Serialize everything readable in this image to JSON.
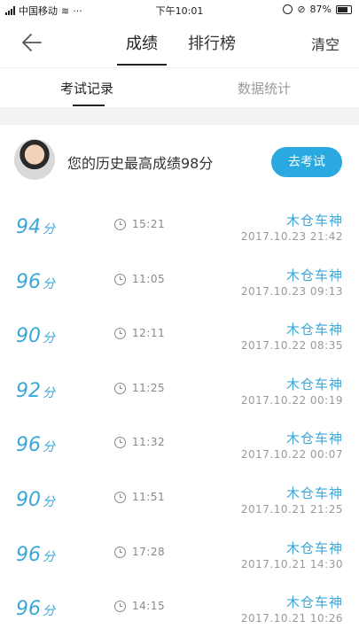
{
  "status_bar": {
    "carrier": "中国移动",
    "dots": "···",
    "time": "下午10:01",
    "battery": "87%"
  },
  "nav": {
    "tab_score": "成绩",
    "tab_rank": "排行榜",
    "clear": "清空"
  },
  "subtabs": {
    "records": "考试记录",
    "stats": "数据统计"
  },
  "summary": {
    "best_text": "您的历史最高成绩98分",
    "exam_button": "去考试"
  },
  "score_unit": "分",
  "records": [
    {
      "score": "94",
      "duration": "15:21",
      "name": "木仓车神",
      "date": "2017.10.23  21:42"
    },
    {
      "score": "96",
      "duration": "11:05",
      "name": "木仓车神",
      "date": "2017.10.23  09:13"
    },
    {
      "score": "90",
      "duration": "12:11",
      "name": "木仓车神",
      "date": "2017.10.22  08:35"
    },
    {
      "score": "92",
      "duration": "11:25",
      "name": "木仓车神",
      "date": "2017.10.22  00:19"
    },
    {
      "score": "96",
      "duration": "11:32",
      "name": "木仓车神",
      "date": "2017.10.22  00:07"
    },
    {
      "score": "90",
      "duration": "11:51",
      "name": "木仓车神",
      "date": "2017.10.21  21:25"
    },
    {
      "score": "96",
      "duration": "17:28",
      "name": "木仓车神",
      "date": "2017.10.21  14:30"
    },
    {
      "score": "96",
      "duration": "14:15",
      "name": "木仓车神",
      "date": "2017.10.21  10:26"
    }
  ],
  "colors": {
    "accent": "#2aa9e0",
    "score_text": "#3aa7d8"
  }
}
